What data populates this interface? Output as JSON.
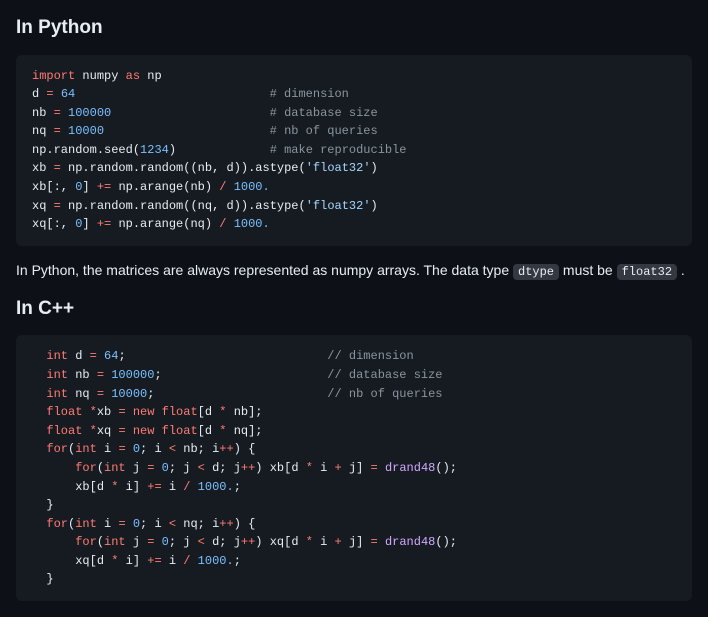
{
  "section1": {
    "heading": "In Python",
    "code_html": "<span class='k-imp'>import</span> <span class='k-id'>numpy</span> <span class='k-kw'>as</span> <span class='k-id'>np</span>\n<span class='k-id'>d</span> <span class='k-op'>=</span> <span class='k-num'>64</span>                           <span class='k-cmt'># dimension</span>\n<span class='k-id'>nb</span> <span class='k-op'>=</span> <span class='k-num'>100000</span>                      <span class='k-cmt'># database size</span>\n<span class='k-id'>nq</span> <span class='k-op'>=</span> <span class='k-num'>10000</span>                       <span class='k-cmt'># nb of queries</span>\n<span class='k-id'>np</span>.<span class='k-id'>random</span>.<span class='k-id'>seed</span>(<span class='k-num'>1234</span>)             <span class='k-cmt'># make reproducible</span>\n<span class='k-id'>xb</span> <span class='k-op'>=</span> <span class='k-id'>np</span>.<span class='k-id'>random</span>.<span class='k-id'>random</span>((<span class='k-id'>nb</span>, <span class='k-id'>d</span>)).<span class='k-id'>astype</span>(<span class='k-str'>'float32'</span>)\n<span class='k-id'>xb</span>[:, <span class='k-num'>0</span>] <span class='k-op'>+=</span> <span class='k-id'>np</span>.<span class='k-id'>arange</span>(<span class='k-id'>nb</span>) <span class='k-op'>/</span> <span class='k-num'>1000.</span>\n<span class='k-id'>xq</span> <span class='k-op'>=</span> <span class='k-id'>np</span>.<span class='k-id'>random</span>.<span class='k-id'>random</span>((<span class='k-id'>nq</span>, <span class='k-id'>d</span>)).<span class='k-id'>astype</span>(<span class='k-str'>'float32'</span>)\n<span class='k-id'>xq</span>[:, <span class='k-num'>0</span>] <span class='k-op'>+=</span> <span class='k-id'>np</span>.<span class='k-id'>arange</span>(<span class='k-id'>nq</span>) <span class='k-op'>/</span> <span class='k-num'>1000.</span>"
  },
  "paragraph": {
    "before": "In Python, the matrices are always represented as numpy arrays. The data type ",
    "code1": "dtype",
    "mid": " must be ",
    "code2": "float32",
    "after": " ."
  },
  "section2": {
    "heading": "In C++",
    "code_html": "  <span class='k-kw'>int</span> <span class='k-id'>d</span> <span class='k-op'>=</span> <span class='k-num'>64</span>;                            <span class='k-cmt'>// dimension</span>\n  <span class='k-kw'>int</span> <span class='k-id'>nb</span> <span class='k-op'>=</span> <span class='k-num'>100000</span>;                       <span class='k-cmt'>// database size</span>\n  <span class='k-kw'>int</span> <span class='k-id'>nq</span> <span class='k-op'>=</span> <span class='k-num'>10000</span>;                        <span class='k-cmt'>// nb of queries</span>\n  <span class='k-kw'>float</span> <span class='k-op'>*</span><span class='k-id'>xb</span> <span class='k-op'>=</span> <span class='k-kw'>new</span> <span class='k-kw'>float</span>[<span class='k-id'>d</span> <span class='k-op'>*</span> <span class='k-id'>nb</span>];\n  <span class='k-kw'>float</span> <span class='k-op'>*</span><span class='k-id'>xq</span> <span class='k-op'>=</span> <span class='k-kw'>new</span> <span class='k-kw'>float</span>[<span class='k-id'>d</span> <span class='k-op'>*</span> <span class='k-id'>nq</span>];\n  <span class='k-kw'>for</span>(<span class='k-kw'>int</span> <span class='k-id'>i</span> <span class='k-op'>=</span> <span class='k-num'>0</span>; <span class='k-id'>i</span> <span class='k-op'>&lt;</span> <span class='k-id'>nb</span>; <span class='k-id'>i</span><span class='k-op'>++</span>) {\n      <span class='k-kw'>for</span>(<span class='k-kw'>int</span> <span class='k-id'>j</span> <span class='k-op'>=</span> <span class='k-num'>0</span>; <span class='k-id'>j</span> <span class='k-op'>&lt;</span> <span class='k-id'>d</span>; <span class='k-id'>j</span><span class='k-op'>++</span>) <span class='k-id'>xb</span>[<span class='k-id'>d</span> <span class='k-op'>*</span> <span class='k-id'>i</span> <span class='k-op'>+</span> <span class='k-id'>j</span>] <span class='k-op'>=</span> <span class='k-fn'>drand48</span>();\n      <span class='k-id'>xb</span>[<span class='k-id'>d</span> <span class='k-op'>*</span> <span class='k-id'>i</span>] <span class='k-op'>+=</span> <span class='k-id'>i</span> <span class='k-op'>/</span> <span class='k-num'>1000.</span>;\n  }\n  <span class='k-kw'>for</span>(<span class='k-kw'>int</span> <span class='k-id'>i</span> <span class='k-op'>=</span> <span class='k-num'>0</span>; <span class='k-id'>i</span> <span class='k-op'>&lt;</span> <span class='k-id'>nq</span>; <span class='k-id'>i</span><span class='k-op'>++</span>) {\n      <span class='k-kw'>for</span>(<span class='k-kw'>int</span> <span class='k-id'>j</span> <span class='k-op'>=</span> <span class='k-num'>0</span>; <span class='k-id'>j</span> <span class='k-op'>&lt;</span> <span class='k-id'>d</span>; <span class='k-id'>j</span><span class='k-op'>++</span>) <span class='k-id'>xq</span>[<span class='k-id'>d</span> <span class='k-op'>*</span> <span class='k-id'>i</span> <span class='k-op'>+</span> <span class='k-id'>j</span>] <span class='k-op'>=</span> <span class='k-fn'>drand48</span>();\n      <span class='k-id'>xq</span>[<span class='k-id'>d</span> <span class='k-op'>*</span> <span class='k-id'>i</span>] <span class='k-op'>+=</span> <span class='k-id'>i</span> <span class='k-op'>/</span> <span class='k-num'>1000.</span>;\n  }"
  }
}
